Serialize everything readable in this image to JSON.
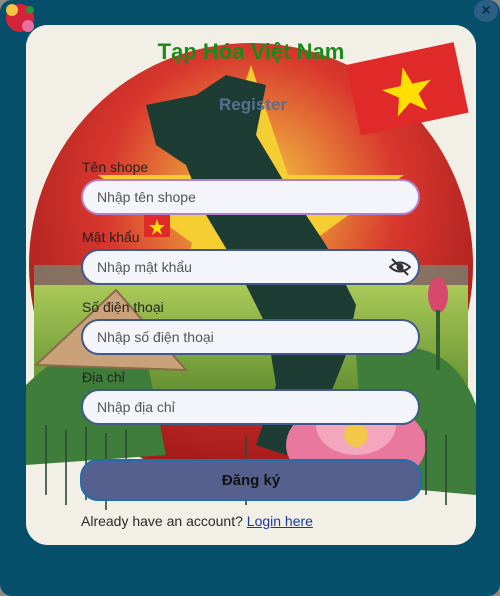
{
  "app": {
    "title": "Tạp Hóa Việt Nam",
    "subtitle": "Register"
  },
  "form": {
    "shop_name": {
      "label": "Tên shope",
      "placeholder": "Nhập tên shope"
    },
    "password": {
      "label": "Mật khẩu",
      "placeholder": "Nhập mật khẩu"
    },
    "phone": {
      "label": "Số điện thoại",
      "placeholder": "Nhập số điện thoại"
    },
    "address": {
      "label": "Địa chỉ",
      "placeholder": "Nhập địa chỉ"
    },
    "submit_label": "Đăng ký"
  },
  "footer": {
    "prompt": "Already have an account?",
    "login_link": "Login here"
  },
  "icons": {
    "close": "close-icon",
    "password_toggle": "eye-off-icon",
    "logo": "logo-icon"
  },
  "colors": {
    "frame": "#064f6b",
    "title": "#1b8a1b",
    "subtitle": "#5a6f94",
    "button": "#55608f",
    "input_border": "#3f5a8a",
    "input_focus": "#b27fce"
  }
}
